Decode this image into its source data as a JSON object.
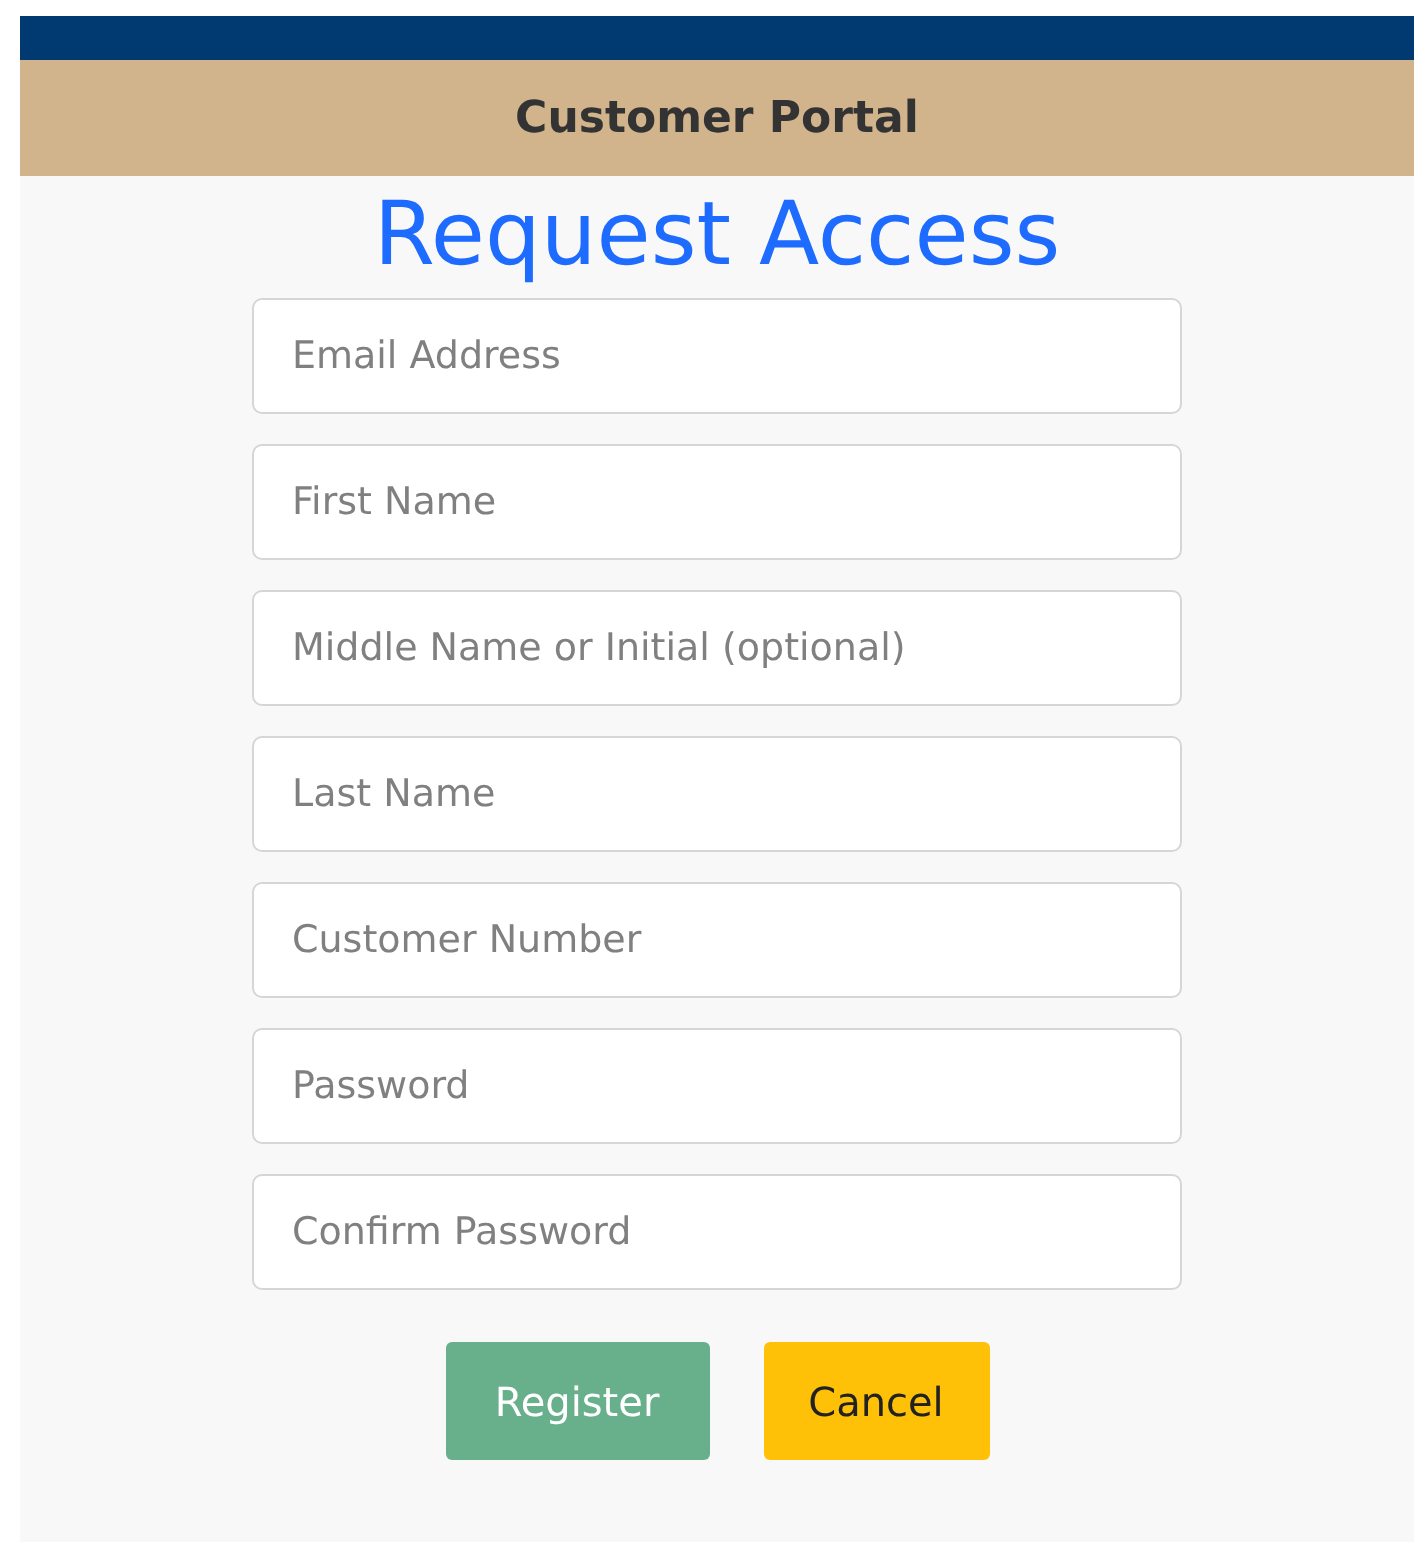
{
  "header": {
    "title": "Customer Portal"
  },
  "heading": "Request Access",
  "fields": [
    {
      "placeholder": "Email Address"
    },
    {
      "placeholder": "First Name"
    },
    {
      "placeholder": "Middle Name or Initial (optional)"
    },
    {
      "placeholder": "Last Name"
    },
    {
      "placeholder": "Customer Number"
    },
    {
      "placeholder": "Password"
    },
    {
      "placeholder": "Confirm Password"
    }
  ],
  "buttons": [
    {
      "label": "Register",
      "kind": "primary"
    },
    {
      "label": "Cancel",
      "kind": "warning"
    }
  ]
}
